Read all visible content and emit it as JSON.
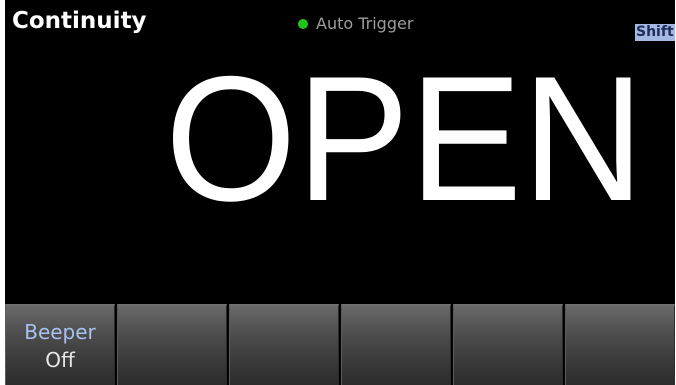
{
  "display": {
    "mode": "Continuity",
    "trigger": {
      "label": "Auto Trigger",
      "indicator_color": "#21c21b",
      "indicator_icon": "status-dot-icon"
    },
    "shift_indicator": "Shift",
    "reading": "OPEN"
  },
  "softkeys": [
    {
      "label": "Beeper",
      "value": "Off"
    },
    {
      "label": "",
      "value": ""
    },
    {
      "label": "",
      "value": ""
    },
    {
      "label": "",
      "value": ""
    },
    {
      "label": "",
      "value": ""
    },
    {
      "label": "",
      "value": ""
    }
  ],
  "colors": {
    "background": "#000000",
    "softkey_label": "#a8c1ef",
    "shift_background": "#a3b8e2"
  }
}
